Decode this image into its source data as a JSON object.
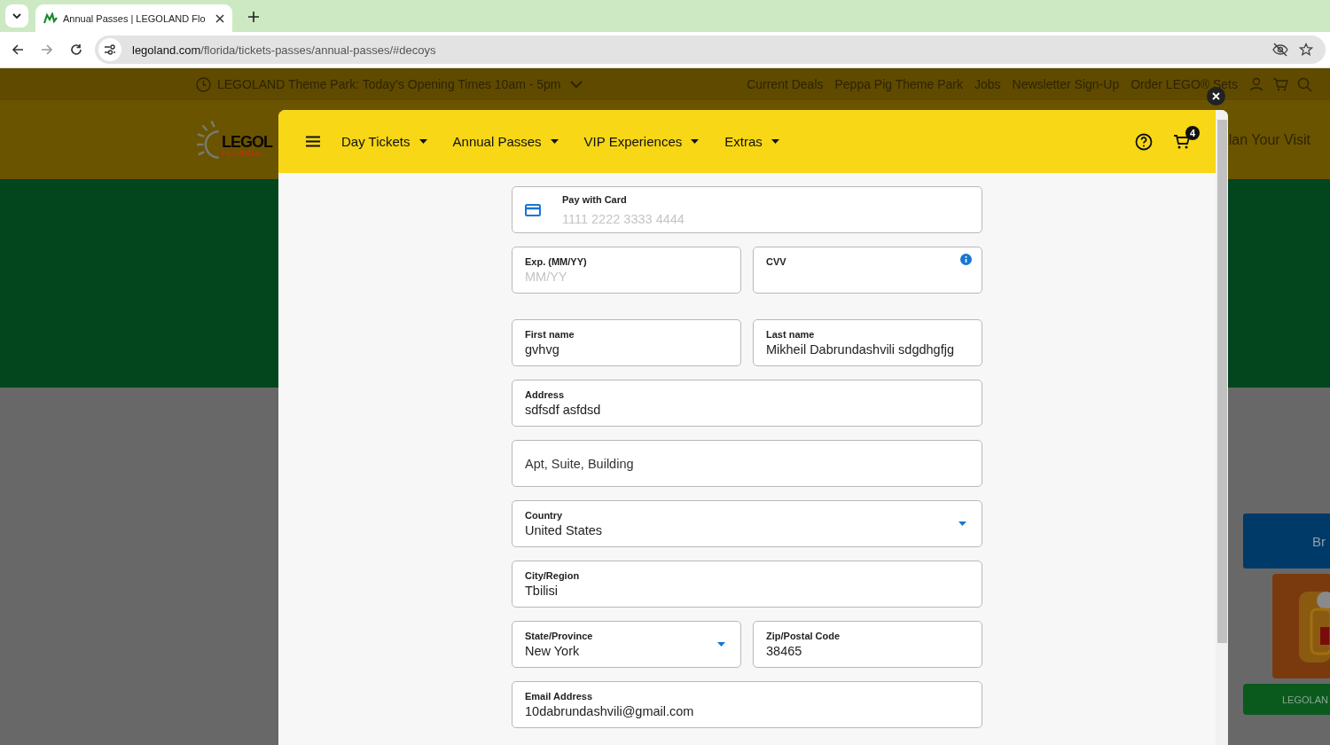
{
  "browser": {
    "tab_title": "Annual Passes | LEGOLAND Flo",
    "url_host": "legoland.com",
    "url_path": "/florida/tickets-passes/annual-passes/#decoys"
  },
  "site": {
    "notice": "LEGOLAND Theme Park: Today’s Opening Times 10am - 5pm",
    "top_links": [
      "Current Deals",
      "Peppa Pig Theme Park",
      "Jobs",
      "Newsletter Sign-Up",
      "Order LEGO® Sets"
    ],
    "logo": {
      "name": "LEGOL",
      "sub": "FLORIDA"
    },
    "header_link": "lan Your Visit",
    "banner": "Br",
    "card_button": "LEGOLAN"
  },
  "modal": {
    "nav": [
      {
        "label": "Day Tickets"
      },
      {
        "label": "Annual Passes"
      },
      {
        "label": "VIP Experiences"
      },
      {
        "label": "Extras"
      }
    ],
    "cart_count": "4",
    "rows": [
      [
        {
          "kind": "card",
          "label": "Pay with Card",
          "placeholder": "1111 2222 3333 4444"
        }
      ],
      [
        {
          "kind": "text",
          "label": "Exp. (MM/YY)",
          "placeholder": "MM/YY"
        },
        {
          "kind": "text",
          "label": "CVV",
          "info": true
        }
      ],
      [
        {
          "kind": "text",
          "label": "First name",
          "value": "gvhvg"
        },
        {
          "kind": "text",
          "label": "Last name",
          "value": "Mikheil Dabrundashvili sdgdhgfjg"
        }
      ],
      [
        {
          "kind": "text",
          "label": "Address",
          "value": "sdfsdf asfdsd"
        }
      ],
      [
        {
          "kind": "text",
          "placeholder": "Apt, Suite, Building"
        }
      ],
      [
        {
          "kind": "select",
          "label": "Country",
          "value": "United States"
        }
      ],
      [
        {
          "kind": "text",
          "label": "City/Region",
          "value": "Tbilisi"
        }
      ],
      [
        {
          "kind": "select",
          "label": "State/Province",
          "value": "New York"
        },
        {
          "kind": "text",
          "label": "Zip/Postal Code",
          "value": "38465"
        }
      ],
      [
        {
          "kind": "text",
          "label": "Email Address",
          "value": "10dabrundashvili@gmail.com"
        }
      ]
    ]
  }
}
